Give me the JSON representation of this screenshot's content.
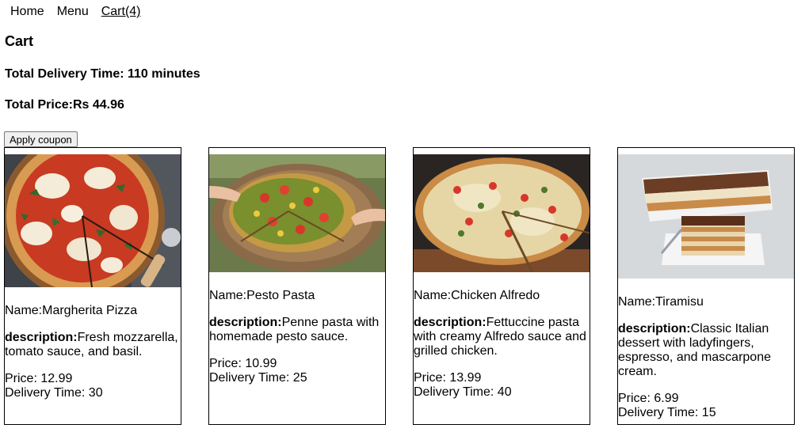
{
  "nav": {
    "home": "Home",
    "menu": "Menu",
    "cart": "Cart(4)"
  },
  "cart": {
    "title": "Cart",
    "total_delivery": "Total Delivery Time: 110 minutes",
    "total_price": "Total Price:Rs 44.96",
    "coupon_label": "Apply coupon"
  },
  "items": [
    {
      "name": "Name:Margherita Pizza",
      "desc_label": "description:",
      "desc": "Fresh mozzarella, tomato sauce, and basil.",
      "price": "Price: 12.99",
      "delivery": "Delivery Time: 30"
    },
    {
      "name": "Name:Pesto Pasta",
      "desc_label": "description:",
      "desc": "Penne pasta with homemade pesto sauce.",
      "price": "Price: 10.99",
      "delivery": "Delivery Time: 25"
    },
    {
      "name": "Name:Chicken Alfredo",
      "desc_label": "description:",
      "desc": "Fettuccine pasta with creamy Alfredo sauce and grilled chicken.",
      "price": "Price: 13.99",
      "delivery": "Delivery Time: 40"
    },
    {
      "name": "Name:Tiramisu",
      "desc_label": "description:",
      "desc": "Classic Italian dessert with ladyfingers, espresso, and mascarpone cream.",
      "price": "Price: 6.99",
      "delivery": "Delivery Time: 15"
    }
  ]
}
